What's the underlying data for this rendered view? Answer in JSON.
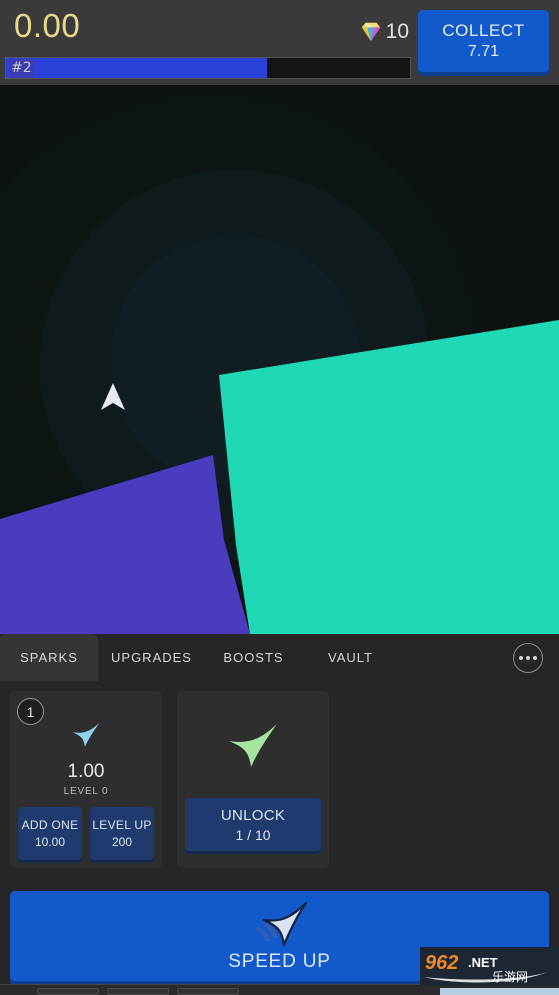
{
  "header": {
    "score": "0.00",
    "gem_icon": "diamond-gem-icon",
    "gem_count": "10",
    "collect_label": "COLLECT",
    "collect_value": "7.71",
    "progress_label": "#2",
    "progress_percent": 64.5,
    "accent_blue": "#1259cc",
    "score_color": "#ead98a"
  },
  "game": {
    "player_icon": "arrow-cursor-icon",
    "teal_color": "#1fd9b4",
    "purple_color": "#4a3bbf",
    "background_color": "#0b1211"
  },
  "tabs": [
    {
      "label": "SPARKS",
      "active": true
    },
    {
      "label": "UPGRADES",
      "active": false
    },
    {
      "label": "BOOSTS",
      "active": false
    },
    {
      "label": "VAULT",
      "active": false
    }
  ],
  "more_button": {
    "icon": "ellipsis-icon"
  },
  "cards": [
    {
      "badge": "1",
      "arrow_icon": "arrow-cursor-icon",
      "arrow_color": "#8fd2ef",
      "value": "1.00",
      "level": "LEVEL 0",
      "buttons": [
        {
          "label": "ADD ONE",
          "sub": "10.00"
        },
        {
          "label": "LEVEL UP",
          "sub": "200"
        }
      ]
    },
    {
      "badge": "",
      "arrow_icon": "arrow-cursor-icon",
      "arrow_color": "#a6e5a0",
      "value": "",
      "level": "",
      "buttons": [
        {
          "label": "UNLOCK",
          "sub": "1 / 10"
        }
      ]
    }
  ],
  "speed_up": {
    "label": "SPEED UP",
    "icon": "fast-cursor-icon"
  },
  "watermark": {
    "digits": "962",
    "tld": ".NET",
    "cn": "乐游网"
  }
}
